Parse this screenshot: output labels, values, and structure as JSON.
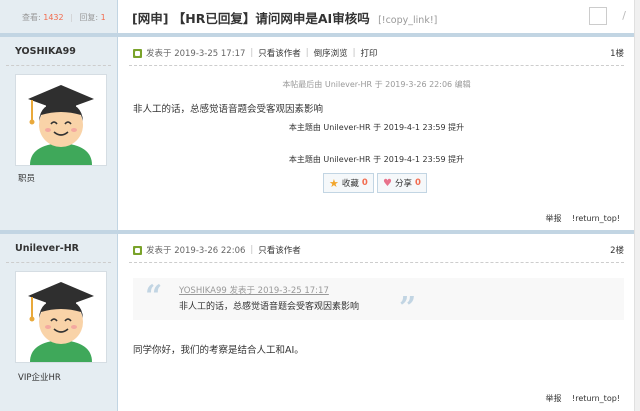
{
  "header": {
    "views_label": "查看:",
    "views": "1432",
    "replies_label": "回复:",
    "replies": "1",
    "title": "[网申] 【HR已回复】请问网申是AI审核吗",
    "copy_link": "[!copy_link!]"
  },
  "posts": [
    {
      "author": "YOSHIKA99",
      "role": "职员",
      "posted": "发表于 2019-3-25 17:17",
      "only_author": "只看该作者",
      "reverse": "倒序浏览",
      "print": "打印",
      "floor": "1楼",
      "edit_note": "本帖最后由 Unilever-HR 于 2019-3-26 22:06 编辑",
      "content": "非人工的话，总感觉语音题会受客观因素影响",
      "bumps": [
        "本主题由 Unilever-HR 于 2019-4-1 23:59 提升",
        "本主题由 Unilever-HR 于 2019-4-1 23:59 提升"
      ],
      "favorite_label": "收藏",
      "favorite_count": "0",
      "share_label": "分享",
      "share_count": "0",
      "report": "举报",
      "return_top": "!return_top!"
    },
    {
      "author": "Unilever-HR",
      "role": "VIP企业HR",
      "posted": "发表于 2019-3-26 22:06",
      "only_author": "只看该作者",
      "floor": "2楼",
      "quote_author": "YOSHIKA99 发表于 2019-3-25 17:17",
      "quote_text": "非人工的话，总感觉语音题会受客观因素影响",
      "content": "同学你好，我们的考察是结合人工和AI。",
      "report": "举报",
      "return_top": "!return_top!"
    }
  ],
  "colors": {
    "sidebar_bg": "#e5edf2",
    "border": "#c2d5e3",
    "accent_red": "#f26c4f",
    "online_green": "#7aa32b"
  },
  "icons": [
    "online-icon",
    "star-icon",
    "heart-icon",
    "avatar-icon",
    "quote-open-icon",
    "quote-close-icon"
  ]
}
